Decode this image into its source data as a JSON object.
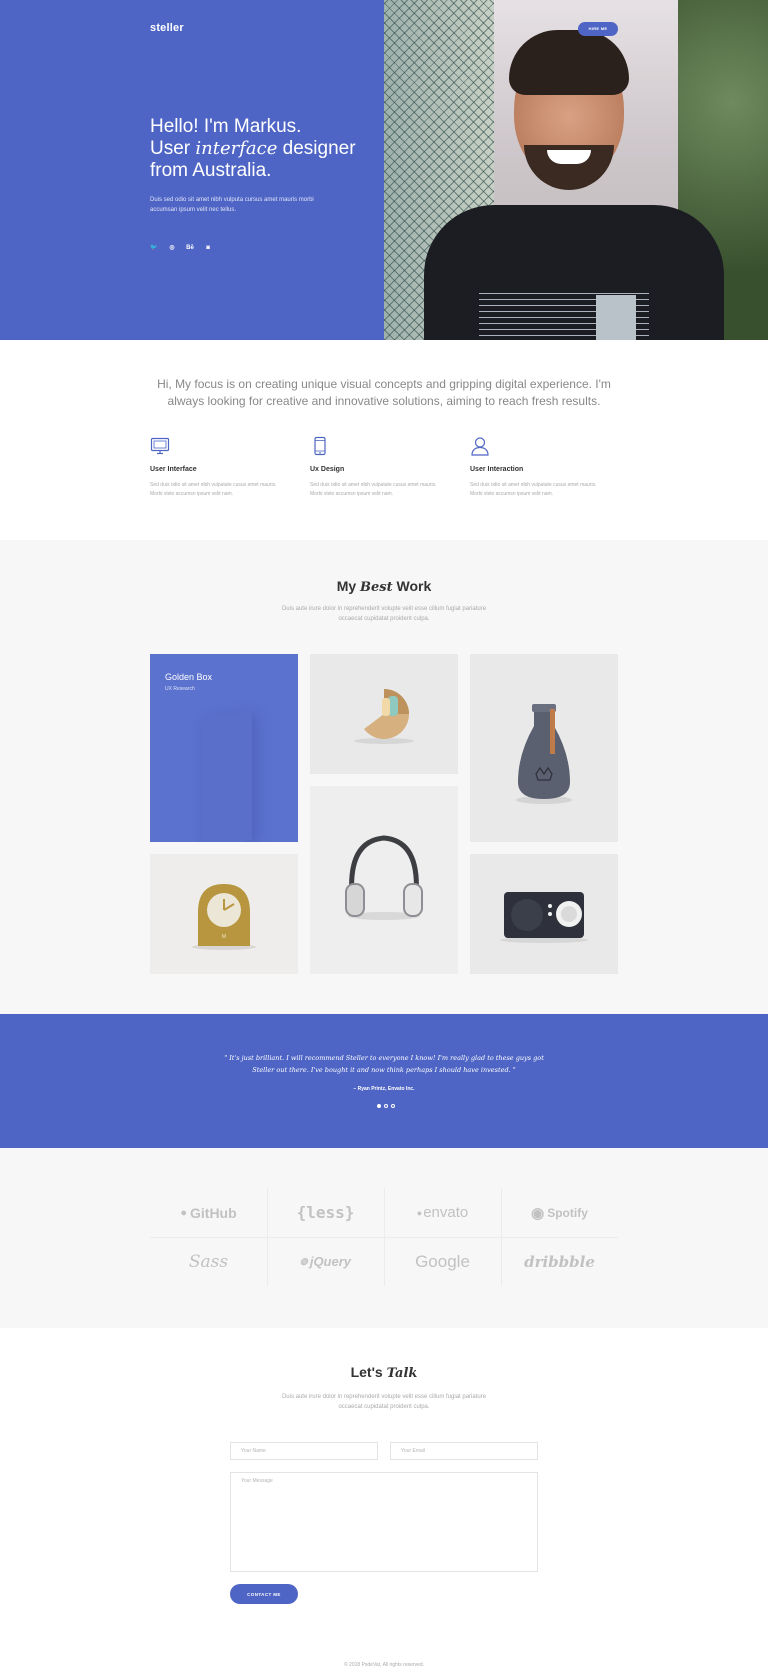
{
  "brand": {
    "logo": "steller",
    "accent": "#4f65c5"
  },
  "header": {
    "hire_label": "HIRE ME"
  },
  "hero": {
    "line1": "Hello! I'm Markus.",
    "line2_pre": "User ",
    "line2_em": "interface",
    "line2_post": " designer",
    "line3": "from Australia.",
    "subtitle": "Duis sed odio sit amet nibh vulputa cursus amet mauris morbi accumsan ipsum velit nec tellus.",
    "socials": [
      {
        "icon": "twitter-icon",
        "glyph": "🐦"
      },
      {
        "icon": "dribbble-icon",
        "glyph": "◎"
      },
      {
        "icon": "behance-icon",
        "glyph": "Bē"
      },
      {
        "icon": "instagram-icon",
        "glyph": "◙"
      }
    ]
  },
  "intro": {
    "text": "Hi, My focus is on creating unique visual concepts and gripping digital experience. I'm always looking for creative and innovative solutions, aiming to reach fresh results.",
    "features": [
      {
        "icon": "monitor-icon",
        "title": "User Interface",
        "text": "Sed duis odio sit amet nibh vulputate cusus amet mauris. Morbi vlele accumsn ipsum velit nam."
      },
      {
        "icon": "mobile-icon",
        "title": "Ux Design",
        "text": "Sed duis odio sit amet nibh vulputate cusus amet mauris. Morbi vlele accumsn ipsum velit nam."
      },
      {
        "icon": "user-icon",
        "title": "User Interaction",
        "text": "Sed duis odio sit amet nibh vulputate cusus amet mauris. Morbi vlele accumsn ipsum velit nam."
      }
    ]
  },
  "work": {
    "title_pre": "My ",
    "title_em": "Best",
    "title_post": " Work",
    "subtitle": "Duis aute irure dolor in reprehenderit volupte velit esse cillum fugiat pariature occaecat cupidatat proident culpa.",
    "featured": {
      "title": "Golden Box",
      "category": "UX Research"
    }
  },
  "testimonial": {
    "quote": "\" It's just brilliant. I will recommend Steller to everyone I know! I'm really glad to these guys got Steller out there. I've bought it and now think perhaps I should have invested. \"",
    "author": "– Ryan Printz, Envato Inc."
  },
  "clients": [
    "GitHub",
    "{less}",
    "envato",
    "Spotify",
    "Sass",
    "jQuery",
    "Google",
    "dribbble"
  ],
  "contact": {
    "title_pre": "Let's ",
    "title_em": "Talk",
    "subtitle": "Duis aute irure dolor in reprehenderit volupte velit esse cillum fugiat pariature occaecat cupidatat proident culpa.",
    "name_placeholder": "Your Name",
    "email_placeholder": "Your Email",
    "message_placeholder": "Your Message",
    "button_label": "CONTACT ME"
  },
  "footer": {
    "text": "© 2018 PsdeVat, All rights reserved."
  }
}
